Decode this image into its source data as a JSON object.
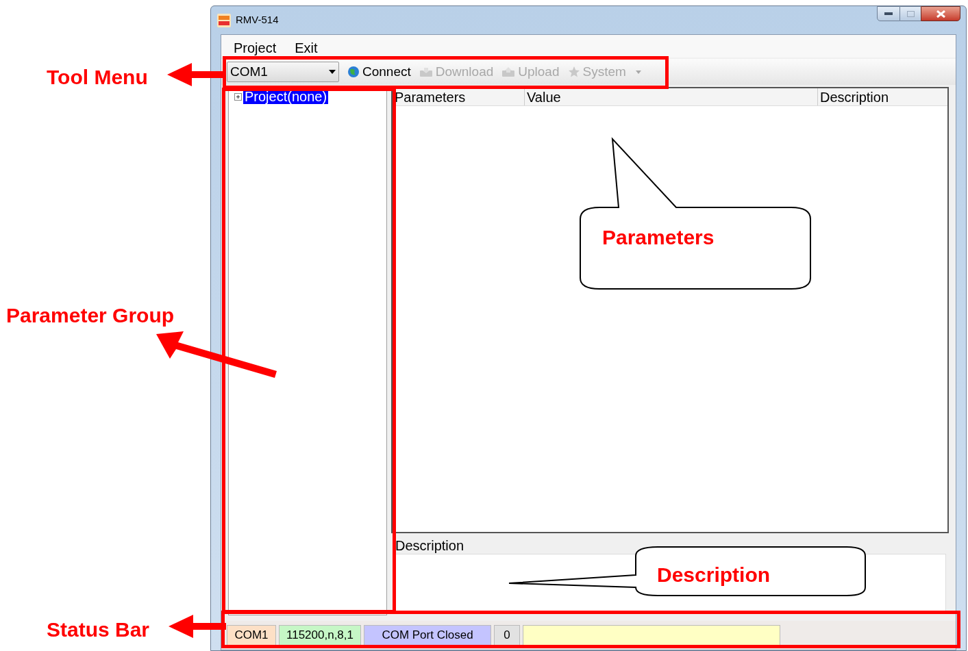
{
  "window": {
    "title": "RMV-514"
  },
  "menu": [
    {
      "label": "Project"
    },
    {
      "label": "Exit"
    }
  ],
  "toolbar": {
    "port": "COM1",
    "buttons": [
      {
        "label": "Connect",
        "kind": "connect",
        "disabled": false
      },
      {
        "label": "Download",
        "kind": "download",
        "disabled": true
      },
      {
        "label": "Upload",
        "kind": "upload",
        "disabled": true
      },
      {
        "label": "System",
        "kind": "system",
        "disabled": true
      }
    ]
  },
  "tree": [
    {
      "label": "Project(none)",
      "selected": true,
      "expanded": false
    }
  ],
  "table": {
    "columns": [
      "Parameters",
      "Value",
      "Description"
    ]
  },
  "description_group": {
    "title": "Description"
  },
  "status_bar": [
    {
      "text": "COM1",
      "color": "#fde0c6"
    },
    {
      "text": "115200,n,8,1",
      "color": "#c6f7c6"
    },
    {
      "text": "COM Port Closed",
      "color": "#c4c4ff"
    },
    {
      "text": "0",
      "color": "#e2e2e2"
    },
    {
      "color": "#ffffc4"
    }
  ],
  "annotations": {
    "labels": [
      "Tool Menu",
      "Parameter Group",
      "Status Bar"
    ],
    "callouts": [
      "Parameters",
      "Description"
    ]
  }
}
